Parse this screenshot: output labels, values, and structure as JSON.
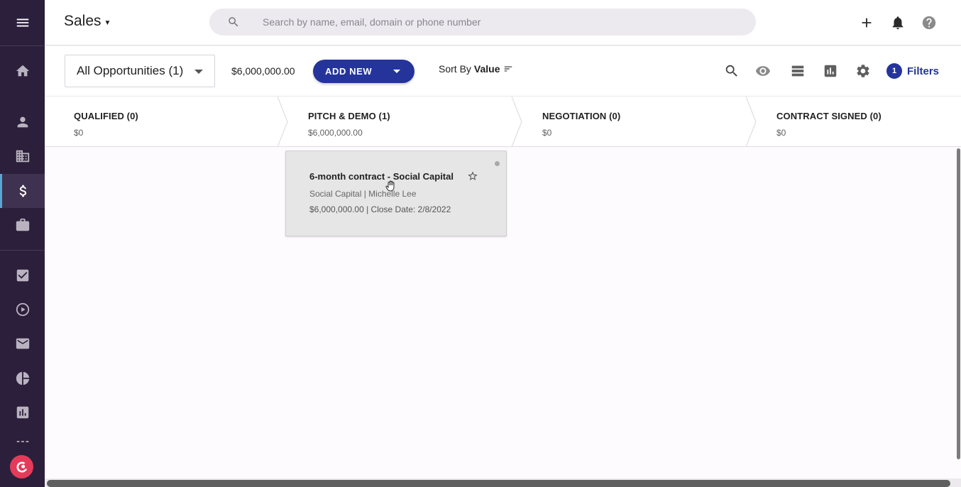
{
  "app": {
    "title": "Sales",
    "search_placeholder": "Search by name, email, domain or phone number"
  },
  "sidebar": {
    "items": [
      {
        "name": "menu"
      },
      {
        "name": "home"
      },
      {
        "name": "people"
      },
      {
        "name": "companies"
      },
      {
        "name": "sales",
        "active": true
      },
      {
        "name": "projects"
      },
      {
        "name": "tasks"
      },
      {
        "name": "activity"
      },
      {
        "name": "email"
      },
      {
        "name": "reports"
      },
      {
        "name": "dashboards"
      },
      {
        "name": "more"
      }
    ]
  },
  "toolbar": {
    "view_label": "All Opportunities (1)",
    "total_value": "$6,000,000.00",
    "add_new_label": "ADD NEW",
    "sort_prefix": "Sort By",
    "sort_value": "Value",
    "filter_count": "1",
    "filters_label": "Filters"
  },
  "stages": [
    {
      "name": "QUALIFIED (0)",
      "amount": "$0"
    },
    {
      "name": "PITCH & DEMO (1)",
      "amount": "$6,000,000.00"
    },
    {
      "name": "NEGOTIATION (0)",
      "amount": "$0"
    },
    {
      "name": "CONTRACT SIGNED (0)",
      "amount": "$0"
    }
  ],
  "cards": [
    {
      "title": "6-month contract - Social Capital",
      "subtitle": "Social Capital | Michelle Lee",
      "meta": "$6,000,000.00 | Close Date: 2/8/2022"
    }
  ],
  "colors": {
    "sidebar_bg": "#2c1f3b",
    "accent": "#24349b",
    "logo": "#e43b5a"
  }
}
